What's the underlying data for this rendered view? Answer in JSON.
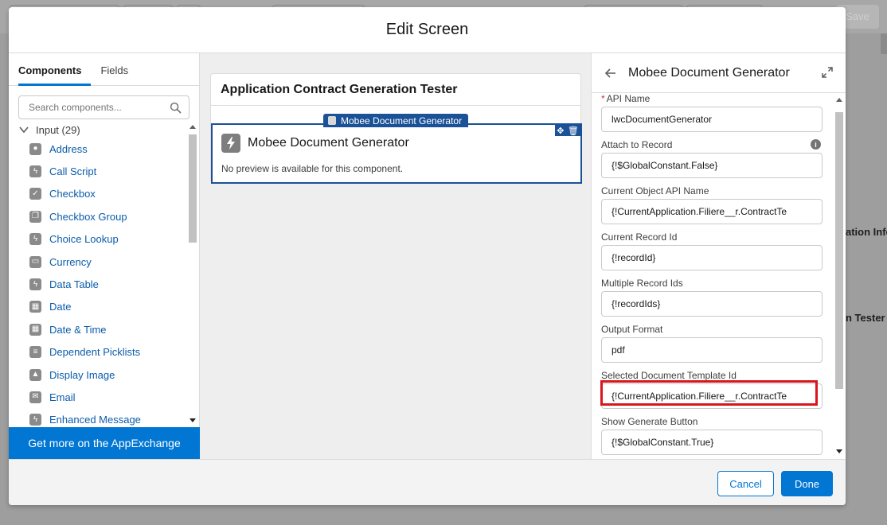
{
  "background": {
    "save_label": "Save",
    "text_1": "ation Info",
    "text_2": "n Tester"
  },
  "modal": {
    "title": "Edit Screen"
  },
  "left_panel": {
    "tabs": [
      {
        "label": "Components",
        "active": true
      },
      {
        "label": "Fields",
        "active": false
      }
    ],
    "search_placeholder": "Search components...",
    "group_label": "Input (29)",
    "components": [
      {
        "label": "Address",
        "icon": "map-pin-icon"
      },
      {
        "label": "Call Script",
        "icon": "bolt-icon"
      },
      {
        "label": "Checkbox",
        "icon": "checkbox-icon"
      },
      {
        "label": "Checkbox Group",
        "icon": "checkbox-group-icon"
      },
      {
        "label": "Choice Lookup",
        "icon": "bolt-icon"
      },
      {
        "label": "Currency",
        "icon": "currency-icon"
      },
      {
        "label": "Data Table",
        "icon": "bolt-icon"
      },
      {
        "label": "Date",
        "icon": "calendar-icon"
      },
      {
        "label": "Date & Time",
        "icon": "calendar-clock-icon"
      },
      {
        "label": "Dependent Picklists",
        "icon": "list-icon"
      },
      {
        "label": "Display Image",
        "icon": "image-icon"
      },
      {
        "label": "Email",
        "icon": "email-icon"
      },
      {
        "label": "Enhanced Message",
        "icon": "bolt-icon"
      }
    ],
    "appexchange_label": "Get more on the AppExchange"
  },
  "canvas": {
    "screen_title": "Application Contract Generation Tester",
    "selected_tag": "Mobee Document Generator",
    "component_name": "Mobee Document Generator",
    "no_preview": "No preview is available for this component."
  },
  "properties": {
    "title": "Mobee Document Generator",
    "fields": [
      {
        "label": "API Name",
        "value": "lwcDocumentGenerator",
        "required": true,
        "info": false,
        "highlighted": false
      },
      {
        "label": "Attach to Record",
        "value": "{!$GlobalConstant.False}",
        "required": false,
        "info": true,
        "highlighted": false
      },
      {
        "label": "Current Object API Name",
        "value": "{!CurrentApplication.Filiere__r.ContractTe",
        "required": false,
        "info": false,
        "highlighted": false
      },
      {
        "label": "Current Record Id",
        "value": "{!recordId}",
        "required": false,
        "info": false,
        "highlighted": false
      },
      {
        "label": "Multiple Record Ids",
        "value": "{!recordIds}",
        "required": false,
        "info": false,
        "highlighted": false
      },
      {
        "label": "Output Format",
        "value": "pdf",
        "required": false,
        "info": false,
        "highlighted": false
      },
      {
        "label": "Selected Document Template Id",
        "value": "{!CurrentApplication.Filiere__r.ContractTe",
        "required": false,
        "info": false,
        "highlighted": true
      },
      {
        "label": "Show Generate Button",
        "value": "{!$GlobalConstant.True}",
        "required": false,
        "info": false,
        "highlighted": false
      }
    ]
  },
  "footer": {
    "cancel_label": "Cancel",
    "done_label": "Done"
  },
  "colors": {
    "brand": "#0176d3",
    "selection": "#1b5297",
    "highlight": "#d8161d",
    "link": "#0b5cab"
  }
}
